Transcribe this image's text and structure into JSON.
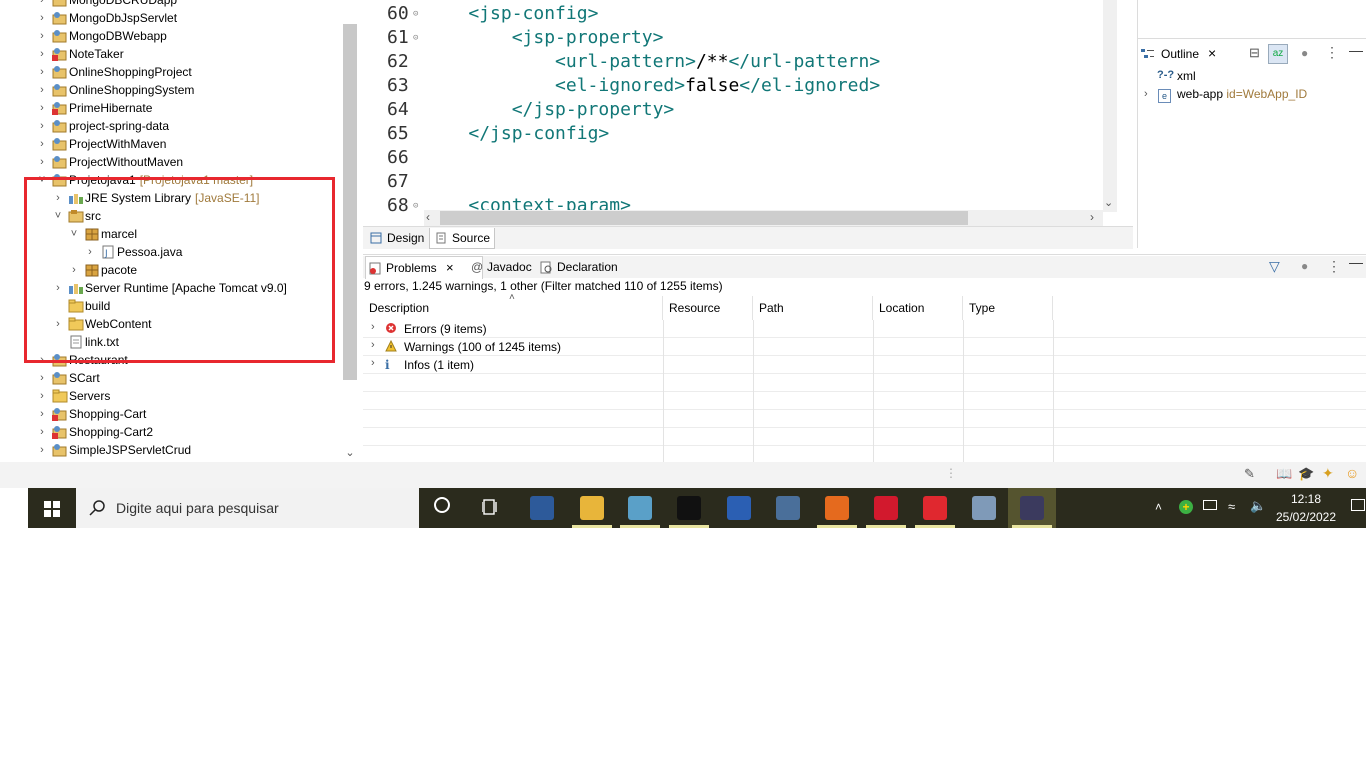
{
  "explorer": {
    "items": [
      {
        "label": "MongoDBCRUDapp",
        "deco": ""
      },
      {
        "label": "MongoDbJspServlet",
        "deco": ""
      },
      {
        "label": "MongoDBWebapp",
        "deco": ""
      },
      {
        "label": "NoteTaker",
        "deco": ""
      },
      {
        "label": "OnlineShoppingProject",
        "deco": ""
      },
      {
        "label": "OnlineShoppingSystem",
        "deco": ""
      },
      {
        "label": "PrimeHibernate",
        "deco": ""
      },
      {
        "label": "project-spring-data",
        "deco": ""
      },
      {
        "label": "ProjectWithMaven",
        "deco": ""
      },
      {
        "label": "ProjectWithoutMaven",
        "deco": ""
      },
      {
        "label": "Projetojava1",
        "deco": "[Projetojava1 master]"
      },
      {
        "label": "JRE System Library",
        "deco": "[JavaSE-11]"
      },
      {
        "label": "src",
        "deco": ""
      },
      {
        "label": "marcel",
        "deco": ""
      },
      {
        "label": "Pessoa.java",
        "deco": ""
      },
      {
        "label": "pacote",
        "deco": ""
      },
      {
        "label": "Server Runtime [Apache Tomcat v9.0]",
        "deco": ""
      },
      {
        "label": "build",
        "deco": ""
      },
      {
        "label": "WebContent",
        "deco": ""
      },
      {
        "label": "link.txt",
        "deco": ""
      },
      {
        "label": "Restaurant",
        "deco": ""
      },
      {
        "label": "SCart",
        "deco": ""
      },
      {
        "label": "Servers",
        "deco": ""
      },
      {
        "label": "Shopping-Cart",
        "deco": ""
      },
      {
        "label": "Shopping-Cart2",
        "deco": ""
      },
      {
        "label": "SimpleJSPServletCrud",
        "deco": ""
      }
    ]
  },
  "editor": {
    "lines": [
      {
        "num": "60",
        "pre": "    ",
        "open": "<jsp-config>",
        "text": "",
        "close": ""
      },
      {
        "num": "61",
        "pre": "        ",
        "open": "<jsp-property>",
        "text": "",
        "close": ""
      },
      {
        "num": "62",
        "pre": "            ",
        "open": "<url-pattern>",
        "text": "/**",
        "close": "</url-pattern>"
      },
      {
        "num": "63",
        "pre": "            ",
        "open": "<el-ignored>",
        "text": "false",
        "close": "</el-ignored>"
      },
      {
        "num": "64",
        "pre": "        ",
        "open": "</jsp-property>",
        "text": "",
        "close": ""
      },
      {
        "num": "65",
        "pre": "    ",
        "open": "</jsp-config>",
        "text": "",
        "close": ""
      },
      {
        "num": "66",
        "pre": "",
        "open": "",
        "text": "",
        "close": ""
      },
      {
        "num": "67",
        "pre": "",
        "open": "",
        "text": "",
        "close": ""
      },
      {
        "num": "68",
        "pre": "    ",
        "open": "<context-param>",
        "text": "",
        "close": ""
      }
    ],
    "tabs": {
      "design": "Design",
      "source": "Source"
    }
  },
  "outline": {
    "title": "Outline",
    "items": [
      {
        "icon": "?-?",
        "label": "xml",
        "attr": ""
      },
      {
        "icon": "e",
        "label": "web-app",
        "attr": "id=WebApp_ID"
      }
    ]
  },
  "problems": {
    "tabs": {
      "problems": "Problems",
      "javadoc": "Javadoc",
      "declaration": "Declaration"
    },
    "summary": "9 errors, 1.245 warnings, 1 other (Filter matched 110 of 1255 items)",
    "columns": [
      "Description",
      "Resource",
      "Path",
      "Location",
      "Type"
    ],
    "rows": [
      {
        "label": "Errors (9 items)"
      },
      {
        "label": "Warnings (100 of 1245 items)"
      },
      {
        "label": "Infos (1 item)"
      }
    ]
  },
  "taskbar": {
    "search_placeholder": "Digite aqui para pesquisar",
    "time": "12:18",
    "date": "25/02/2022"
  },
  "colors": {
    "highlight": "#e8282f",
    "xml_tag": "#117777"
  }
}
